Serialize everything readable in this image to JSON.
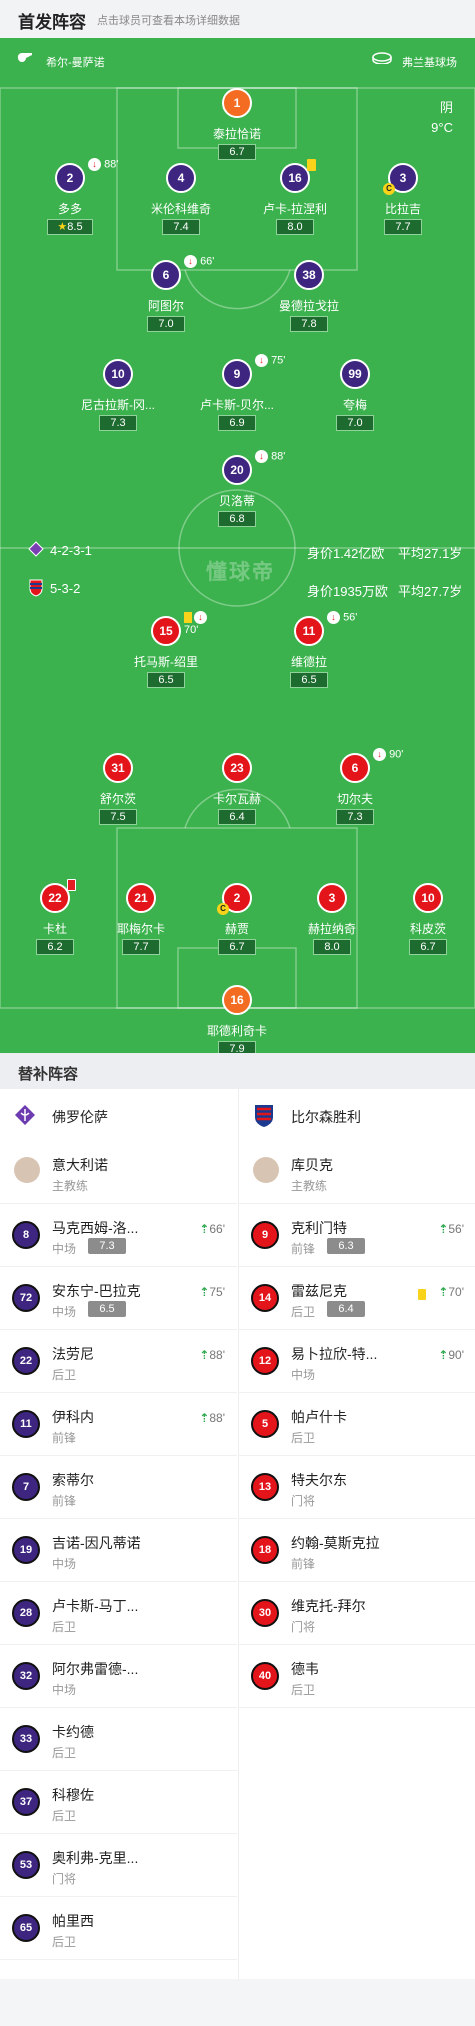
{
  "header": {
    "title": "首发阵容",
    "subtitle": "点击球员可查看本场详细数据"
  },
  "pitch": {
    "home_label": "希尔-曼萨诺",
    "away_label": "弗兰基球场",
    "weather": "阴",
    "temp": "9°C",
    "watermark": "懂球帝",
    "home_team": {
      "formation": "4-2-3-1",
      "value": "身价1.42亿欧",
      "age": "平均27.1岁"
    },
    "away_team": {
      "formation": "5-3-2",
      "value": "身价1935万欧",
      "age": "平均27.7岁"
    }
  },
  "players": [
    {
      "num": "1",
      "name": "泰拉恰诺",
      "rating": "6.7",
      "color": "gk"
    },
    {
      "num": "2",
      "name": "多多",
      "rating": "8.5",
      "color": "purple",
      "sub": "88'",
      "best": true
    },
    {
      "num": "4",
      "name": "米伦科维奇",
      "rating": "7.4",
      "color": "purple"
    },
    {
      "num": "16",
      "name": "卢卡-拉涅利",
      "rating": "8.0",
      "color": "purple",
      "yellow": true
    },
    {
      "num": "3",
      "name": "比拉吉",
      "rating": "7.7",
      "color": "purple",
      "captain": true
    },
    {
      "num": "6",
      "name": "阿图尔",
      "rating": "7.0",
      "color": "purple",
      "sub": "66'"
    },
    {
      "num": "38",
      "name": "曼德拉戈拉",
      "rating": "7.8",
      "color": "purple"
    },
    {
      "num": "10",
      "name": "尼古拉斯-冈...",
      "rating": "7.3",
      "color": "purple"
    },
    {
      "num": "9",
      "name": "卢卡斯-贝尔...",
      "rating": "6.9",
      "color": "purple",
      "sub": "75'"
    },
    {
      "num": "99",
      "name": "夸梅",
      "rating": "7.0",
      "color": "purple"
    },
    {
      "num": "20",
      "name": "贝洛蒂",
      "rating": "6.8",
      "color": "purple",
      "sub": "88'"
    },
    {
      "num": "15",
      "name": "托马斯-绍里",
      "rating": "6.5",
      "color": "red",
      "sub": "70'",
      "yellow": true
    },
    {
      "num": "11",
      "name": "维德拉",
      "rating": "6.5",
      "color": "red",
      "sub": "56'"
    },
    {
      "num": "31",
      "name": "舒尔茨",
      "rating": "7.5",
      "color": "red"
    },
    {
      "num": "23",
      "name": "卡尔瓦赫",
      "rating": "6.4",
      "color": "red"
    },
    {
      "num": "6",
      "name": "切尔夫",
      "rating": "7.3",
      "color": "red",
      "sub": "90'"
    },
    {
      "num": "22",
      "name": "卡杜",
      "rating": "6.2",
      "color": "red",
      "red": true
    },
    {
      "num": "21",
      "name": "耶梅尔卡",
      "rating": "7.7",
      "color": "red"
    },
    {
      "num": "2",
      "name": "赫贾",
      "rating": "6.7",
      "color": "red",
      "captain": true
    },
    {
      "num": "3",
      "name": "赫拉纳奇",
      "rating": "8.0",
      "color": "red"
    },
    {
      "num": "10",
      "name": "科皮茨",
      "rating": "6.7",
      "color": "red"
    },
    {
      "num": "16",
      "name": "耶德利奇卡",
      "rating": "7.9",
      "color": "gk"
    }
  ],
  "subs": {
    "title": "替补阵容",
    "home": {
      "team": "佛罗伦萨",
      "coach_name": "意大利诺",
      "coach_role": "主教练",
      "rows": [
        {
          "num": "8",
          "name": "马克西姆-洛...",
          "pos": "中场",
          "rating": "7.3",
          "in": "66'"
        },
        {
          "num": "72",
          "name": "安东宁-巴拉克",
          "pos": "中场",
          "rating": "6.5",
          "in": "75'"
        },
        {
          "num": "22",
          "name": "法劳尼",
          "pos": "后卫",
          "in": "88'"
        },
        {
          "num": "11",
          "name": "伊科内",
          "pos": "前锋",
          "in": "88'"
        },
        {
          "num": "7",
          "name": "索蒂尔",
          "pos": "前锋"
        },
        {
          "num": "19",
          "name": "吉诺-因凡蒂诺",
          "pos": "中场"
        },
        {
          "num": "28",
          "name": "卢卡斯-马丁...",
          "pos": "后卫"
        },
        {
          "num": "32",
          "name": "阿尔弗雷德-...",
          "pos": "中场"
        },
        {
          "num": "33",
          "name": "卡约德",
          "pos": "后卫"
        },
        {
          "num": "37",
          "name": "科穆佐",
          "pos": "后卫"
        },
        {
          "num": "53",
          "name": "奥利弗-克里...",
          "pos": "门将"
        },
        {
          "num": "65",
          "name": "帕里西",
          "pos": "后卫"
        }
      ]
    },
    "away": {
      "team": "比尔森胜利",
      "coach_name": "库贝克",
      "coach_role": "主教练",
      "rows": [
        {
          "num": "9",
          "name": "克利门特",
          "pos": "前锋",
          "rating": "6.3",
          "in": "56'"
        },
        {
          "num": "14",
          "name": "雷兹尼克",
          "pos": "后卫",
          "rating": "6.4",
          "in": "70'",
          "yellow": true
        },
        {
          "num": "12",
          "name": "易卜拉欣-特...",
          "pos": "中场",
          "in": "90'"
        },
        {
          "num": "5",
          "name": "帕卢什卡",
          "pos": "后卫"
        },
        {
          "num": "13",
          "name": "特夫尔东",
          "pos": "门将"
        },
        {
          "num": "18",
          "name": "约翰-莫斯克拉",
          "pos": "前锋"
        },
        {
          "num": "30",
          "name": "维克托-拜尔",
          "pos": "门将"
        },
        {
          "num": "40",
          "name": "德韦",
          "pos": "后卫"
        }
      ]
    }
  }
}
